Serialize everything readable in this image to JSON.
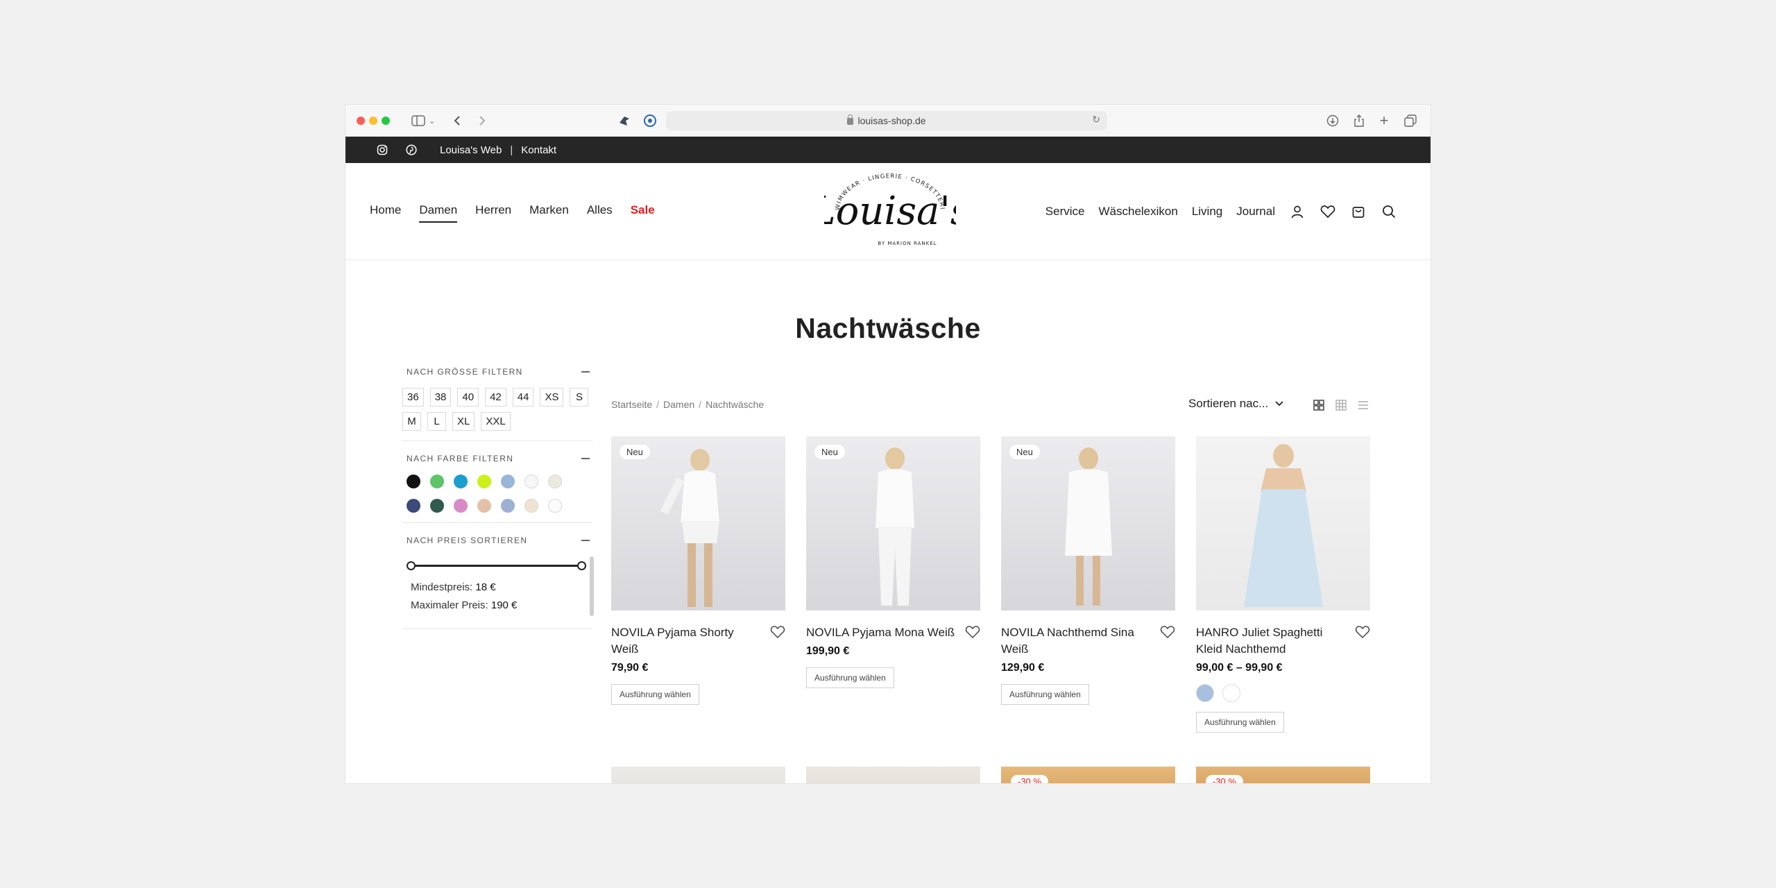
{
  "browser": {
    "url": "louisas-shop.de"
  },
  "topbar": {
    "icons": [
      "instagram-icon",
      "pinterest-icon"
    ],
    "links": [
      "Louisa's Web",
      "Kontakt"
    ],
    "separator": "|"
  },
  "header": {
    "nav_left": [
      "Home",
      "Damen",
      "Herren",
      "Marken",
      "Alles",
      "Sale"
    ],
    "active": "Damen",
    "logo": {
      "script": "Louisa's",
      "top_text": "SWIMWEAR · LINGERIE · CORSETTERIA",
      "bottom_text": "BY MARION RANKEL"
    },
    "nav_right": [
      "Service",
      "Wäschelexikon",
      "Living",
      "Journal"
    ],
    "icons": [
      "account-icon",
      "wishlist-icon",
      "cart-icon",
      "search-icon"
    ]
  },
  "page": {
    "title": "Nachtwäsche"
  },
  "breadcrumb": [
    "Startseite",
    "Damen",
    "Nachtwäsche"
  ],
  "breadcrumb_sep": "/",
  "sort": {
    "label": "Sortieren nac..."
  },
  "filters": {
    "size": {
      "title": "NACH GRÖSSE FILTERN",
      "options": [
        "36",
        "38",
        "40",
        "42",
        "44",
        "XS",
        "S",
        "M",
        "L",
        "XL",
        "XXL"
      ]
    },
    "color": {
      "title": "NACH FARBE FILTERN",
      "swatches": [
        "#111111",
        "#5dc468",
        "#1a9fcf",
        "#cdf01a",
        "#97b6da",
        "#f7f7f7",
        "#ece9dd",
        "#3b4a78",
        "#2f5a4d",
        "#d98bc6",
        "#e3c1a6",
        "#9db0d3",
        "#efe4d2",
        "#fbfbfb"
      ]
    },
    "price": {
      "title": "NACH PREIS SORTIEREN",
      "min_label": "Mindestpreis:",
      "min_value": "18 €",
      "max_label": "Maximaler Preis:",
      "max_value": "190 €"
    }
  },
  "products": [
    {
      "badge": "Neu",
      "name": "NOVILA Pyjama Shorty Weiß",
      "price": "79,90 €",
      "button": "Ausführung wählen"
    },
    {
      "badge": "Neu",
      "name": "NOVILA Pyjama Mona Weiß",
      "price": "199,90 €",
      "button": "Ausführung wählen"
    },
    {
      "badge": "Neu",
      "name": "NOVILA Nachthemd Sina Weiß",
      "price": "129,90 €",
      "button": "Ausführung wählen"
    },
    {
      "badge": "",
      "name": "HANRO Juliet Spaghetti Kleid Nachthemd",
      "price": "99,00 € – 99,90 €",
      "button": "Ausführung wählen",
      "variants": [
        "#a8bfdf",
        "#ffffff"
      ]
    }
  ],
  "next_row_badges": [
    "",
    "",
    "-30 %",
    "-30 %"
  ],
  "accent": {
    "sale": "#e0201b",
    "topbar": "#262626"
  }
}
